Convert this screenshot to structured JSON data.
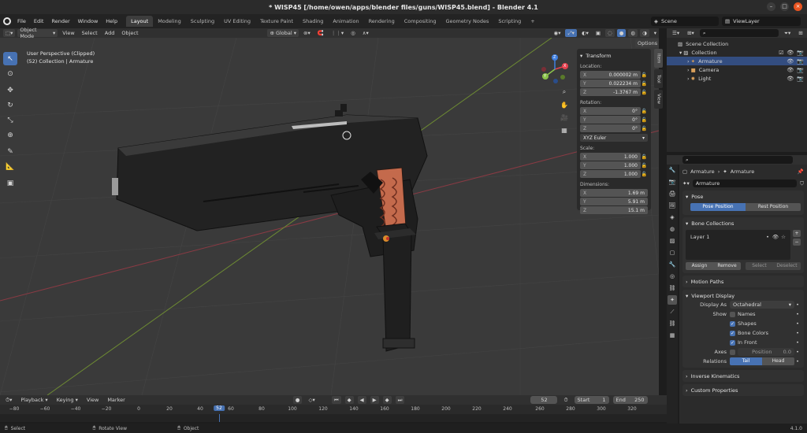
{
  "window": {
    "title": "* WISP45 [/home/owen/apps/blender files/guns/WISP45.blend] - Blender 4.1"
  },
  "menubar": {
    "menus": [
      "File",
      "Edit",
      "Render",
      "Window",
      "Help"
    ],
    "workspaces": [
      "Layout",
      "Modeling",
      "Sculpting",
      "UV Editing",
      "Texture Paint",
      "Shading",
      "Animation",
      "Rendering",
      "Compositing",
      "Geometry Nodes",
      "Scripting"
    ],
    "add_tab": "+",
    "scene": "Scene",
    "view_layer": "ViewLayer"
  },
  "viewport_header": {
    "mode": "Object Mode",
    "menus": [
      "View",
      "Select",
      "Add",
      "Object"
    ],
    "orientation": "Global",
    "options": "Options"
  },
  "viewport": {
    "view_name": "User Perspective (Clipped)",
    "context": "(52) Collection | Armature",
    "gizmo": {
      "x": "X",
      "y": "Y",
      "z": "Z"
    }
  },
  "npanel": {
    "section": "Transform",
    "location_label": "Location:",
    "location": [
      {
        "k": "X",
        "v": "0.000002 m"
      },
      {
        "k": "Y",
        "v": "0.022234 m"
      },
      {
        "k": "Z",
        "v": "-1.3767 m"
      }
    ],
    "rotation_label": "Rotation:",
    "rotation": [
      {
        "k": "X",
        "v": "0°"
      },
      {
        "k": "Y",
        "v": "0°"
      },
      {
        "k": "Z",
        "v": "0°"
      }
    ],
    "rotation_mode": "XYZ Euler",
    "scale_label": "Scale:",
    "scale": [
      {
        "k": "X",
        "v": "1.000"
      },
      {
        "k": "Y",
        "v": "1.000"
      },
      {
        "k": "Z",
        "v": "1.000"
      }
    ],
    "dimensions_label": "Dimensions:",
    "dimensions": [
      {
        "k": "X",
        "v": "1.69 m"
      },
      {
        "k": "Y",
        "v": "5.91 m"
      },
      {
        "k": "Z",
        "v": "15.1 m"
      }
    ],
    "tabs": [
      "Item",
      "Tool",
      "View"
    ]
  },
  "outliner": {
    "rows": [
      {
        "name": "Scene Collection"
      },
      {
        "name": "Collection"
      },
      {
        "name": "Armature"
      },
      {
        "name": "Camera"
      },
      {
        "name": "Light"
      }
    ]
  },
  "properties": {
    "object": "Armature",
    "data": "Armature",
    "data_name": "Armature",
    "pose": {
      "title": "Pose",
      "pose_position": "Pose Position",
      "rest_position": "Rest Position"
    },
    "bone_collections": {
      "title": "Bone Collections",
      "layer": "Layer 1",
      "assign": "Assign",
      "remove": "Remove",
      "select": "Select",
      "deselect": "Deselect"
    },
    "motion_paths": "Motion Paths",
    "viewport_display": {
      "title": "Viewport Display",
      "display_as_label": "Display As",
      "display_as": "Octahedral",
      "show_label": "Show",
      "names": "Names",
      "shapes": "Shapes",
      "bone_colors": "Bone Colors",
      "in_front": "In Front",
      "axes_label": "Axes",
      "position_label": "Position",
      "position_value": "0.0",
      "relations_label": "Relations",
      "tail": "Tail",
      "head": "Head"
    },
    "inverse_kinematics": "Inverse Kinematics",
    "custom_properties": "Custom Properties"
  },
  "timeline": {
    "menus": [
      "Playback",
      "Keying",
      "View",
      "Marker"
    ],
    "current_frame": "52",
    "start_label": "Start",
    "start": "1",
    "end_label": "End",
    "end": "250",
    "ticks": [
      "−80",
      "−60",
      "−40",
      "−20",
      "0",
      "20",
      "40",
      "52",
      "60",
      "80",
      "100",
      "120",
      "140",
      "160",
      "180",
      "200",
      "220",
      "240",
      "260",
      "280",
      "300",
      "320"
    ]
  },
  "status": {
    "select": "Select",
    "rotate": "Rotate View",
    "object": "Object",
    "version": "4.1.0"
  },
  "colors": {
    "accent": "#4772b3",
    "selected_row": "#334d80",
    "x_axis": "#e5414f",
    "y_axis": "#8bc34a",
    "z_axis": "#3f7fe0"
  }
}
